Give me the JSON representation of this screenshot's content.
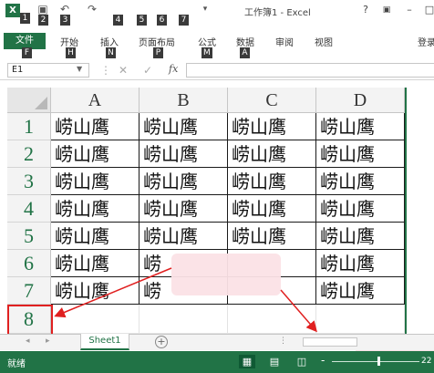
{
  "window": {
    "title": "工作簿1 - Excel",
    "help": "?",
    "minimize": "–"
  },
  "quick_access": {
    "keytips": [
      "1",
      "2",
      "3",
      "4",
      "5",
      "6",
      "7"
    ]
  },
  "ribbon": {
    "file_label": "文件",
    "file_keytip": "F",
    "tabs": [
      {
        "label": "开始",
        "keytip": "H"
      },
      {
        "label": "插入",
        "keytip": "N"
      },
      {
        "label": "页面布局",
        "keytip": "P"
      },
      {
        "label": "公式",
        "keytip": "M"
      },
      {
        "label": "数据",
        "keytip": "A"
      },
      {
        "label": "审阅",
        "keytip": ""
      },
      {
        "label": "视图",
        "keytip": ""
      }
    ],
    "signin_label": "登录"
  },
  "formula_bar": {
    "name_box": "E1",
    "fx": "fx",
    "value": ""
  },
  "grid": {
    "columns": [
      "A",
      "B",
      "C",
      "D"
    ],
    "rows": [
      "1",
      "2",
      "3",
      "4",
      "5",
      "6",
      "7",
      "8"
    ],
    "cells": [
      [
        "崂山鹰",
        "崂山鹰",
        "崂山鹰",
        "崂山鹰"
      ],
      [
        "崂山鹰",
        "崂山鹰",
        "崂山鹰",
        "崂山鹰"
      ],
      [
        "崂山鹰",
        "崂山鹰",
        "崂山鹰",
        "崂山鹰"
      ],
      [
        "崂山鹰",
        "崂山鹰",
        "崂山鹰",
        "崂山鹰"
      ],
      [
        "崂山鹰",
        "崂山鹰",
        "崂山鹰",
        "崂山鹰"
      ],
      [
        "崂山鹰",
        "崂",
        "",
        "崂山鹰"
      ],
      [
        "崂山鹰",
        "崂",
        "",
        "崂山鹰"
      ],
      [
        "",
        "",
        "",
        ""
      ]
    ]
  },
  "sheets": {
    "active": "Sheet1",
    "add_label": "+"
  },
  "status": {
    "ready": "就绪",
    "zoom_minus": "-",
    "zoom_level": "22"
  },
  "colors": {
    "excel_green": "#217346",
    "annotation_red": "#e02020"
  },
  "icons": [
    "excel-logo-icon",
    "save-icon",
    "undo-icon",
    "redo-icon",
    "cancel-icon",
    "confirm-icon",
    "scroll-left-icon",
    "scroll-right-icon",
    "normal-view-icon",
    "page-layout-view-icon",
    "page-break-view-icon"
  ]
}
